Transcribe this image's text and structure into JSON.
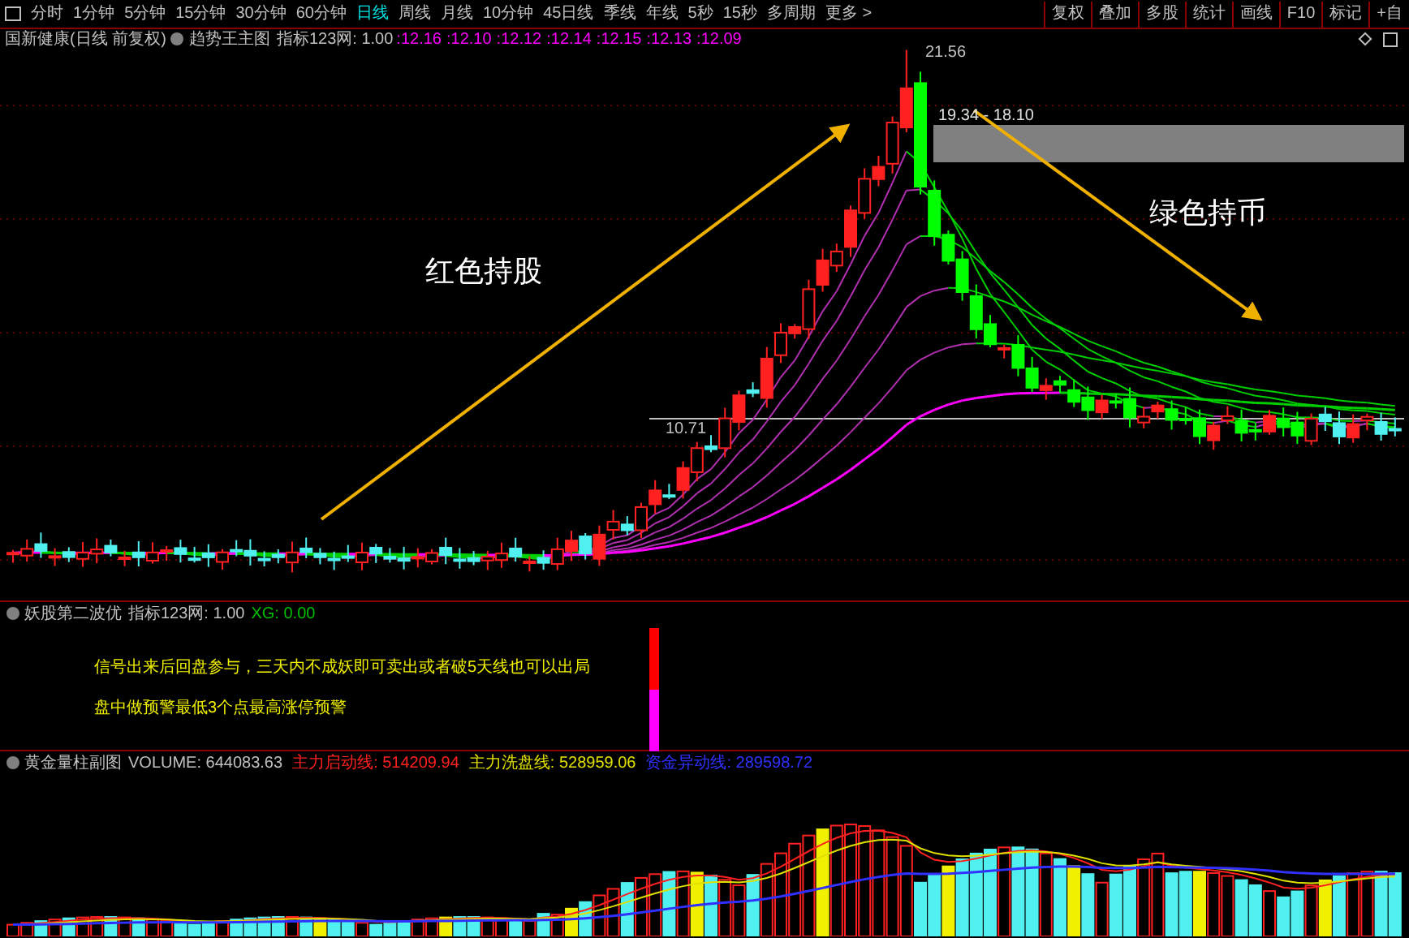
{
  "toolbar": {
    "periods": [
      {
        "label": "分时",
        "selected": false
      },
      {
        "label": "1分钟",
        "selected": false
      },
      {
        "label": "5分钟",
        "selected": false
      },
      {
        "label": "15分钟",
        "selected": false
      },
      {
        "label": "30分钟",
        "selected": false
      },
      {
        "label": "60分钟",
        "selected": false
      },
      {
        "label": "日线",
        "selected": true
      },
      {
        "label": "周线",
        "selected": false
      },
      {
        "label": "月线",
        "selected": false
      },
      {
        "label": "10分钟",
        "selected": false
      },
      {
        "label": "45日线",
        "selected": false
      },
      {
        "label": "季线",
        "selected": false
      },
      {
        "label": "年线",
        "selected": false
      },
      {
        "label": "5秒",
        "selected": false
      },
      {
        "label": "15秒",
        "selected": false
      },
      {
        "label": "多周期",
        "selected": false
      },
      {
        "label": "更多 >",
        "selected": false
      }
    ],
    "buttons": [
      "复权",
      "叠加",
      "多股",
      "统计",
      "画线",
      "F10",
      "标记",
      "+自"
    ]
  },
  "main_panel": {
    "stock_name": "国新健康(日线 前复权)",
    "indicator_name": "趋势王主图",
    "indicator_param": "指标123网: 1.00",
    "ma_values": [
      ":12.16",
      ":12.10",
      ":12.12",
      ":12.14",
      ":12.15",
      ":12.13",
      ":12.09"
    ],
    "high_label": "21.56",
    "box_label": "19.34 - 18.10",
    "support_label": "10.71",
    "annotations": [
      "红色持股",
      "绿色持币"
    ]
  },
  "signal_panel": {
    "indicator_name": "妖股第二波优",
    "indicator_param": "指标123网: 1.00",
    "xg": "XG: 0.00",
    "notes": [
      "信号出来后回盘参与，三天内不成妖即可卖出或者破5天线也可以出局",
      "盘中做预警最低3个点最高涨停预警"
    ]
  },
  "volume_panel": {
    "indicator_name": "黄金量柱副图",
    "readings": [
      {
        "text": "VOLUME: 644083.63",
        "color": "#c0c0c0"
      },
      {
        "text": "主力启动线: 514209.94",
        "color": "#ff2020"
      },
      {
        "text": "主力洗盘线: 528959.06",
        "color": "#e0e000"
      },
      {
        "text": "资金异动线: 289598.72",
        "color": "#3030ff"
      }
    ]
  }
}
